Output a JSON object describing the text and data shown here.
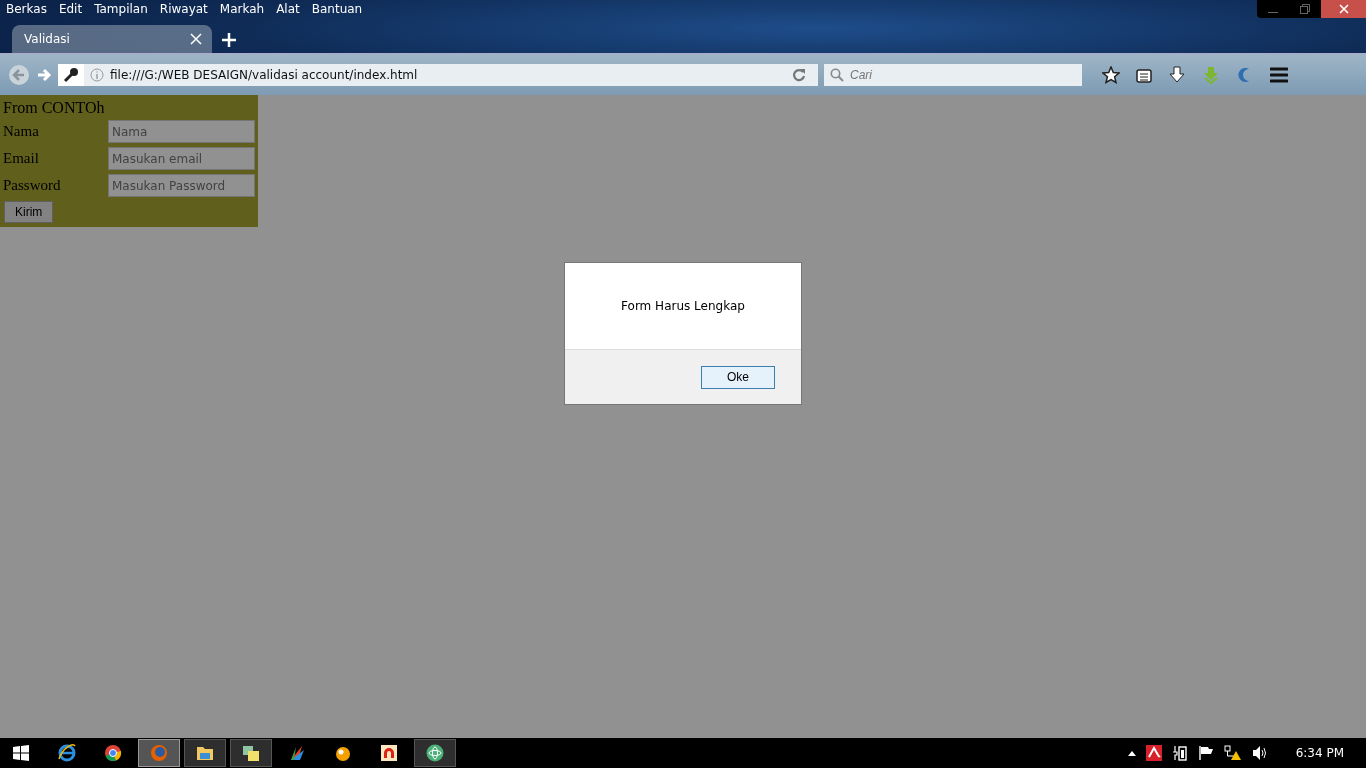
{
  "menu_bar": [
    "Berkas",
    "Edit",
    "Tampilan",
    "Riwayat",
    "Markah",
    "Alat",
    "Bantuan"
  ],
  "tabs": [
    {
      "label": "Validasi",
      "selected": true
    }
  ],
  "address_bar": {
    "value": "file:///G:/WEB DESAIGN/validasi account/index.html"
  },
  "search": {
    "placeholder": "Cari"
  },
  "form": {
    "title": "From CONTOh",
    "fields": [
      {
        "label": "Nama",
        "placeholder": "Nama"
      },
      {
        "label": "Email",
        "placeholder": "Masukan email"
      },
      {
        "label": "Password",
        "placeholder": "Masukan Password"
      }
    ],
    "submit": "Kirim"
  },
  "dialog": {
    "message": "Form Harus Lengkap",
    "button": "Oke"
  },
  "taskbar": [
    {
      "kind": "start",
      "running": false,
      "selected": false
    },
    {
      "kind": "ie",
      "running": false,
      "selected": false
    },
    {
      "kind": "chrome",
      "running": false,
      "selected": false
    },
    {
      "kind": "firefox",
      "running": true,
      "selected": true
    },
    {
      "kind": "folder",
      "running": true,
      "selected": false
    },
    {
      "kind": "photos",
      "running": true,
      "selected": false
    },
    {
      "kind": "fan",
      "running": false,
      "selected": false
    },
    {
      "kind": "orange",
      "running": false,
      "selected": false
    },
    {
      "kind": "arch",
      "running": false,
      "selected": false
    },
    {
      "kind": "atom",
      "running": true,
      "selected": false
    }
  ],
  "clock": "6:34 PM"
}
